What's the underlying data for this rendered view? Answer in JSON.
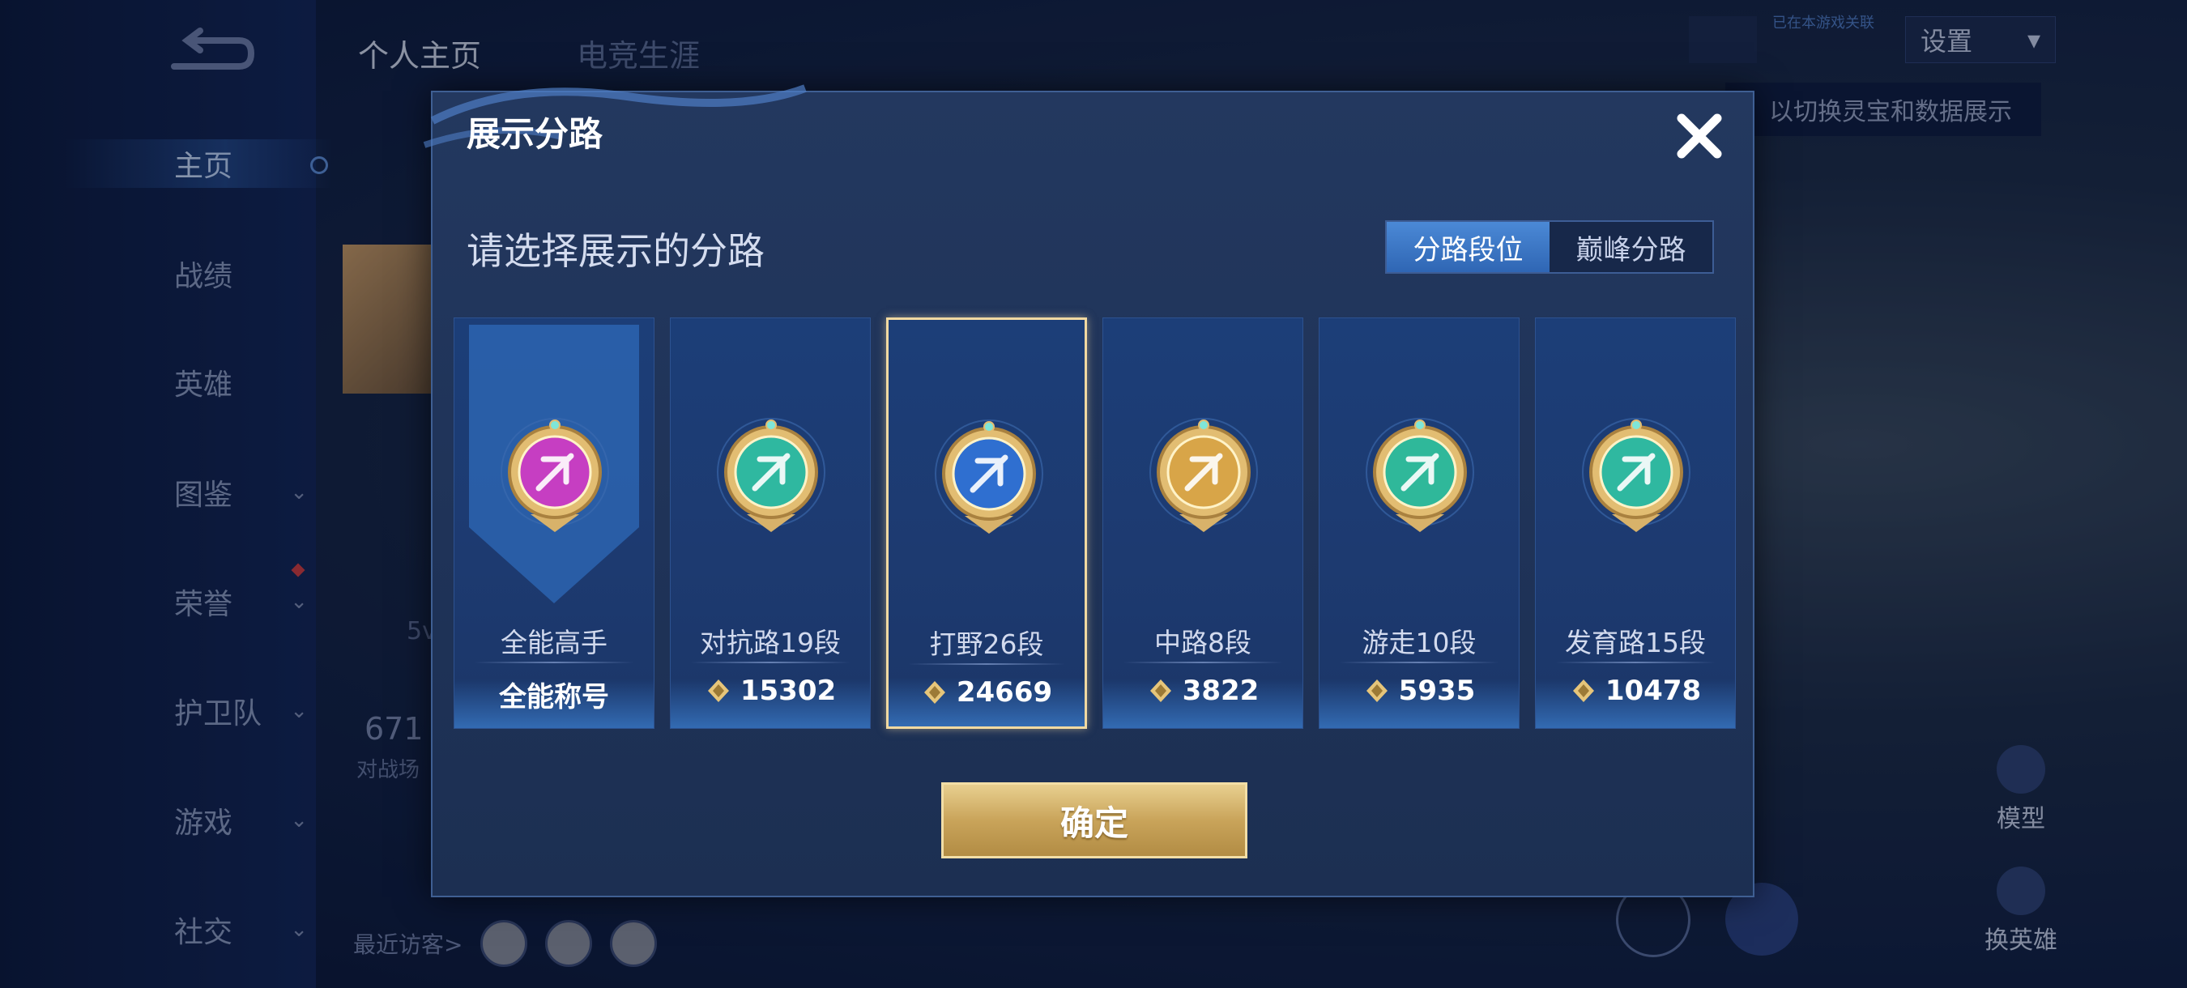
{
  "sidebar": {
    "items": [
      {
        "label": "主页",
        "active": true,
        "chevron": false
      },
      {
        "label": "战绩",
        "active": false,
        "chevron": false
      },
      {
        "label": "英雄",
        "active": false,
        "chevron": false
      },
      {
        "label": "图鉴",
        "active": false,
        "chevron": true
      },
      {
        "label": "荣誉",
        "active": false,
        "chevron": true
      },
      {
        "label": "护卫队",
        "active": false,
        "chevron": true
      },
      {
        "label": "游戏",
        "active": false,
        "chevron": true
      },
      {
        "label": "社交",
        "active": false,
        "chevron": true
      }
    ]
  },
  "background": {
    "tabs": [
      "个人主页",
      "电竞生涯"
    ],
    "settings_label": "设置",
    "hint_text": "以切换灵宝和数据展示",
    "note_text": "已在本游戏关联",
    "model_label": "模型",
    "swap_hero_label": "换英雄",
    "stat_value": "671",
    "stat_caption": "对战场",
    "recent_visitors_label": "最近访客>",
    "mode_text": "5v"
  },
  "modal": {
    "title": "展示分路",
    "subtitle": "请选择展示的分路",
    "toggle": {
      "options": [
        "分路段位",
        "巅峰分路"
      ],
      "selected_index": 0
    },
    "cards": [
      {
        "lane": "全能高手",
        "value": "全能称号",
        "emblem": "all-round-emblem",
        "color": "#c63ec2",
        "selected": false,
        "has_gem": false
      },
      {
        "lane": "对抗路19段",
        "value": "15302",
        "emblem": "clash-lane-emblem",
        "color": "#2fb8a0",
        "selected": false,
        "has_gem": true
      },
      {
        "lane": "打野26段",
        "value": "24669",
        "emblem": "jungle-emblem",
        "color": "#2f6fd0",
        "selected": true,
        "has_gem": true
      },
      {
        "lane": "中路8段",
        "value": "3822",
        "emblem": "mid-lane-emblem",
        "color": "#d8a548",
        "selected": false,
        "has_gem": true
      },
      {
        "lane": "游走10段",
        "value": "5935",
        "emblem": "roam-emblem",
        "color": "#2fb89a",
        "selected": false,
        "has_gem": true
      },
      {
        "lane": "发育路15段",
        "value": "10478",
        "emblem": "farm-lane-emblem",
        "color": "#2fb8a0",
        "selected": false,
        "has_gem": true
      }
    ],
    "confirm_label": "确定"
  },
  "colors": {
    "accent_gold": "#e8cf8f",
    "panel_blue": "#23385f",
    "toggle_active": "#4b89d6"
  }
}
